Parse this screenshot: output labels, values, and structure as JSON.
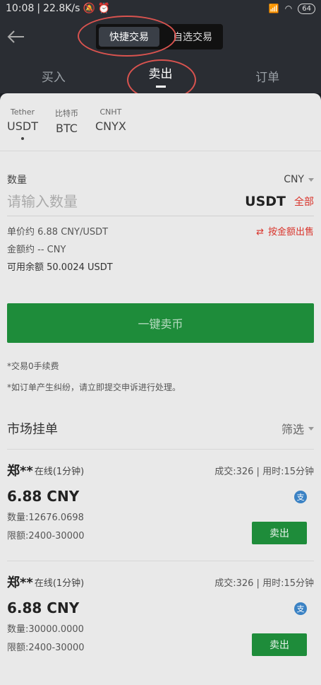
{
  "status_bar": {
    "time": "10:08",
    "speed": "22.8K/s",
    "battery": "64"
  },
  "header": {
    "mode_tabs": [
      "快捷交易",
      "自选交易"
    ],
    "active_mode": 0
  },
  "tabs": [
    {
      "label": "买入"
    },
    {
      "label": "卖出"
    },
    {
      "label": "订单"
    }
  ],
  "coins": [
    {
      "sub": "Tether",
      "main": "USDT"
    },
    {
      "sub": "比特币",
      "main": "BTC"
    },
    {
      "sub": "CNHT",
      "main": "CNYX"
    }
  ],
  "form": {
    "qty_label": "数量",
    "currency": "CNY",
    "placeholder": "请输入数量",
    "unit": "USDT",
    "all_label": "全部",
    "unit_price": "单价约 6.88 CNY/USDT",
    "amount": "金额约 -- CNY",
    "balance": "可用余额 50.0024 USDT",
    "switch_label": "按金额出售",
    "sell_button": "一键卖币",
    "note1": "*交易0手续费",
    "note2": "*如订单产生纠纷，请立即提交申诉进行处理。"
  },
  "market": {
    "title": "市场挂单",
    "filter": "筛选",
    "orders": [
      {
        "name": "郑**",
        "online": "在线(1分钟)",
        "stats": "成交:326 | 用时:15分钟",
        "price": "6.88 CNY",
        "qty": "数量:12676.0698",
        "limit": "限额:2400-30000",
        "pay": "支",
        "button": "卖出"
      },
      {
        "name": "郑**",
        "online": "在线(1分钟)",
        "stats": "成交:326 | 用时:15分钟",
        "price": "6.88 CNY",
        "qty": "数量:30000.0000",
        "limit": "限额:2400-30000",
        "pay": "支",
        "button": "卖出"
      }
    ]
  }
}
